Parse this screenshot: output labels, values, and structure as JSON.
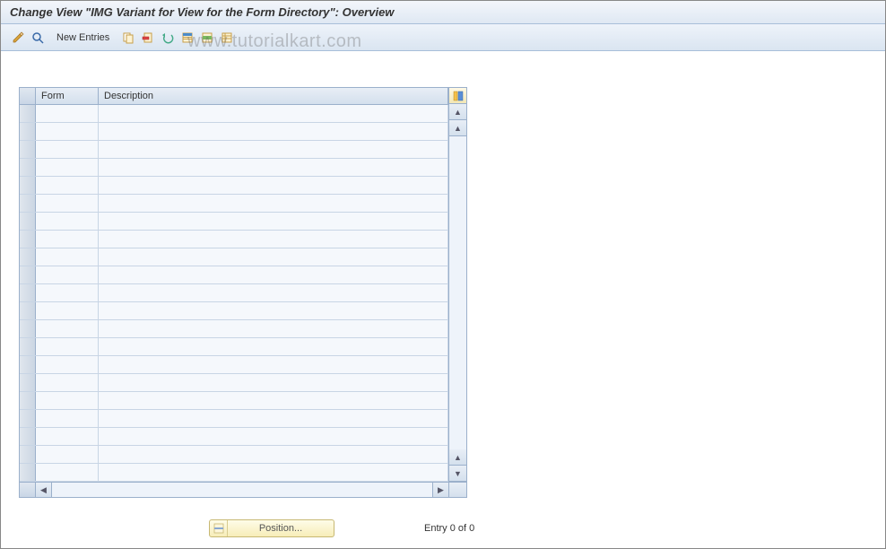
{
  "title": "Change View \"IMG Variant for View for the Form Directory\": Overview",
  "watermark": "www.tutorialkart.com",
  "toolbar": {
    "new_entries_label": "New Entries"
  },
  "table": {
    "columns": {
      "form": "Form",
      "description": "Description"
    },
    "row_count": 21,
    "rows": [
      {
        "form": "",
        "description": ""
      },
      {
        "form": "",
        "description": ""
      },
      {
        "form": "",
        "description": ""
      },
      {
        "form": "",
        "description": ""
      },
      {
        "form": "",
        "description": ""
      },
      {
        "form": "",
        "description": ""
      },
      {
        "form": "",
        "description": ""
      },
      {
        "form": "",
        "description": ""
      },
      {
        "form": "",
        "description": ""
      },
      {
        "form": "",
        "description": ""
      },
      {
        "form": "",
        "description": ""
      },
      {
        "form": "",
        "description": ""
      },
      {
        "form": "",
        "description": ""
      },
      {
        "form": "",
        "description": ""
      },
      {
        "form": "",
        "description": ""
      },
      {
        "form": "",
        "description": ""
      },
      {
        "form": "",
        "description": ""
      },
      {
        "form": "",
        "description": ""
      },
      {
        "form": "",
        "description": ""
      },
      {
        "form": "",
        "description": ""
      },
      {
        "form": "",
        "description": ""
      }
    ]
  },
  "footer": {
    "position_label": "Position...",
    "entry_text": "Entry 0 of 0"
  }
}
